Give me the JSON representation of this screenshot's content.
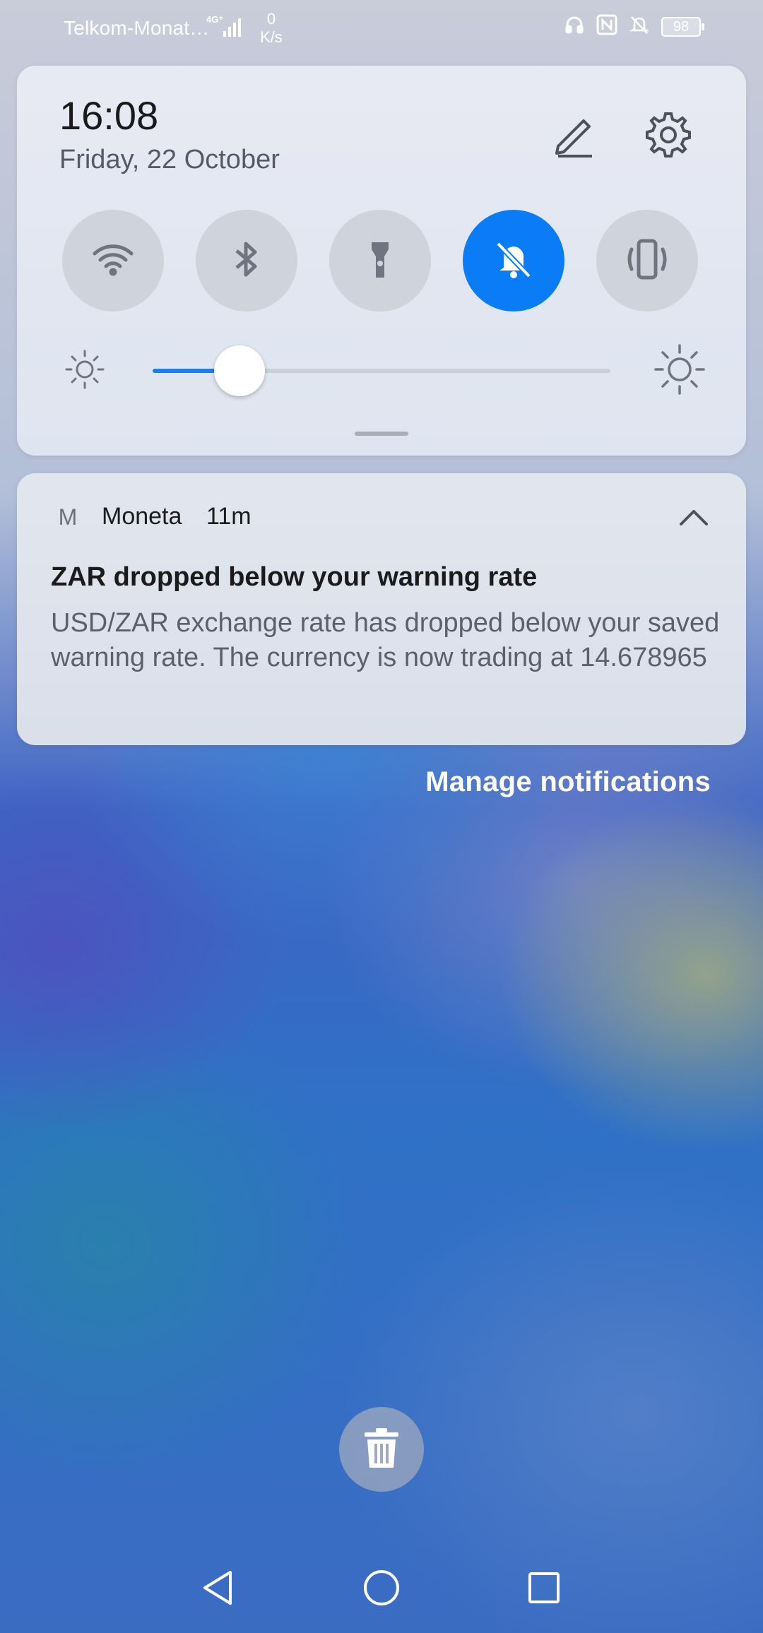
{
  "status_bar": {
    "carrier": "Telkom-Monat…",
    "network_type": "4G⁺",
    "network_speed_value": "0",
    "network_speed_unit": "K/s",
    "battery_percent": "98",
    "icons": [
      "signal-icon",
      "headphones-icon",
      "nfc-icon",
      "mute-bell-icon",
      "battery-icon"
    ]
  },
  "quick_settings": {
    "time": "16:08",
    "date": "Friday, 22 October",
    "edit_icon": "pencil-icon",
    "settings_icon": "gear-icon",
    "tiles": [
      {
        "name": "wifi",
        "icon": "wifi-icon",
        "active": false
      },
      {
        "name": "bluetooth",
        "icon": "bluetooth-icon",
        "active": false
      },
      {
        "name": "flashlight",
        "icon": "flashlight-icon",
        "active": false
      },
      {
        "name": "silent",
        "icon": "bell-off-icon",
        "active": true
      },
      {
        "name": "vibrate",
        "icon": "vibrate-icon",
        "active": false
      }
    ],
    "brightness_level": 0.19,
    "accent_color": "#0a7cf5"
  },
  "notification": {
    "app_icon_letter": "M",
    "app_name": "Moneta",
    "time_ago": "11m",
    "title": "ZAR dropped below your warning rate",
    "body": "USD/ZAR exchange rate has dropped below your saved warning rate. The currency is now trading at 14.678965"
  },
  "manage_notifications_label": "Manage notifications",
  "clear_all_icon": "trash-icon",
  "navigation": {
    "back_icon": "back-triangle-icon",
    "home_icon": "home-circle-icon",
    "recents_icon": "recents-square-icon"
  }
}
